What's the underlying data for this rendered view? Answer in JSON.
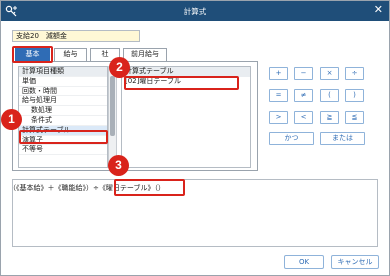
{
  "window": {
    "title": "計算式",
    "close_label": "✕"
  },
  "item_field": {
    "value": "支給20　減額金"
  },
  "tabs": [
    {
      "label": "基本",
      "active": true
    },
    {
      "label": "給与",
      "active": false
    },
    {
      "label": "社",
      "active": false
    },
    {
      "label": "前月給与",
      "active": false
    }
  ],
  "category_list": {
    "header": "計算項目種類",
    "items": [
      "単価",
      "回数・時間",
      "給与処理月",
      "数処理",
      "条件式",
      "計算式テーブル",
      "演算子",
      "不等号"
    ],
    "selected": "計算式テーブル"
  },
  "table_list": {
    "header": "計算式テーブル",
    "items": [
      "[02]曜日テーブル"
    ]
  },
  "operators": {
    "row1": [
      "+",
      "−",
      "×",
      "÷"
    ],
    "row2": [
      "=",
      "≠",
      "(",
      ")"
    ],
    "row3": [
      ">",
      "<",
      "≧",
      "≦"
    ],
    "row4": [
      "かつ",
      "または"
    ]
  },
  "formula": {
    "before": "（《基本給》＋《職能給》）÷",
    "inserted": "《曜日テーブル》（）"
  },
  "footer": {
    "ok_label": "OK",
    "cancel_label": "キャンセル"
  },
  "badges": [
    "1",
    "2",
    "3"
  ],
  "colors": {
    "titlebar": "#1f4e79",
    "accent": "#2f6cb5",
    "highlight": "#d9231b"
  }
}
